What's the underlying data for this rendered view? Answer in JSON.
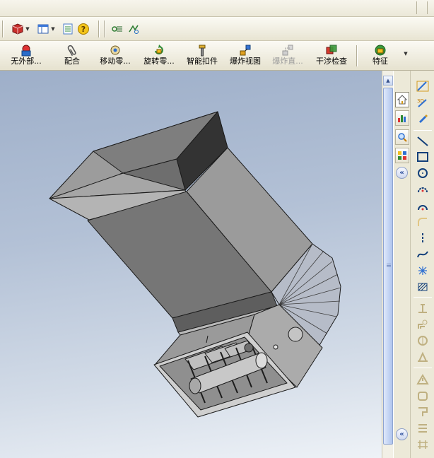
{
  "toolbar_top": {
    "icons": [
      "3d-box-icon",
      "view-layout-icon",
      "list-icon",
      "help-icon",
      "flow-icon",
      "rebuild-icon"
    ]
  },
  "command_manager": {
    "items": [
      {
        "label": "无外部...",
        "icon": "hide-external-icon",
        "disabled": false
      },
      {
        "label": "配合",
        "icon": "mate-paperclip-icon",
        "disabled": false
      },
      {
        "label": "移动零...",
        "icon": "move-component-icon",
        "disabled": false
      },
      {
        "label": "旋转零...",
        "icon": "rotate-component-icon",
        "disabled": false
      },
      {
        "label": "智能扣件",
        "icon": "smart-fastener-icon",
        "disabled": false
      },
      {
        "label": "爆炸视图",
        "icon": "exploded-view-icon",
        "disabled": false
      },
      {
        "label": "爆炸直...",
        "icon": "explode-line-icon",
        "disabled": true
      },
      {
        "label": "干涉检查",
        "icon": "interference-check-icon",
        "disabled": false
      },
      {
        "label": "特征",
        "icon": "features-icon",
        "disabled": false
      }
    ]
  },
  "task_pane": {
    "tabs": [
      "home-icon",
      "design-library-icon",
      "file-explorer-icon",
      "view-palette-icon"
    ]
  },
  "sketch_tools": [
    "smart-dimension-icon",
    "sketch-icon",
    "3d-sketch-icon",
    "line-icon",
    "rectangle-icon",
    "circle-icon",
    "arc-icon",
    "tangent-arc-icon",
    "fillet-icon",
    "centerline-icon",
    "spline-icon",
    "point-icon",
    "hatch-icon",
    "trim-icon",
    "offset-icon",
    "mirror-icon",
    "relation-icon",
    "fix-icon",
    "extend-icon",
    "convert-icon"
  ],
  "colors": {
    "viewport_top": "#9eafc9",
    "viewport_bottom": "#eef2f7",
    "part_face": "#8d8d8d",
    "part_edge": "#1b1b1b"
  }
}
